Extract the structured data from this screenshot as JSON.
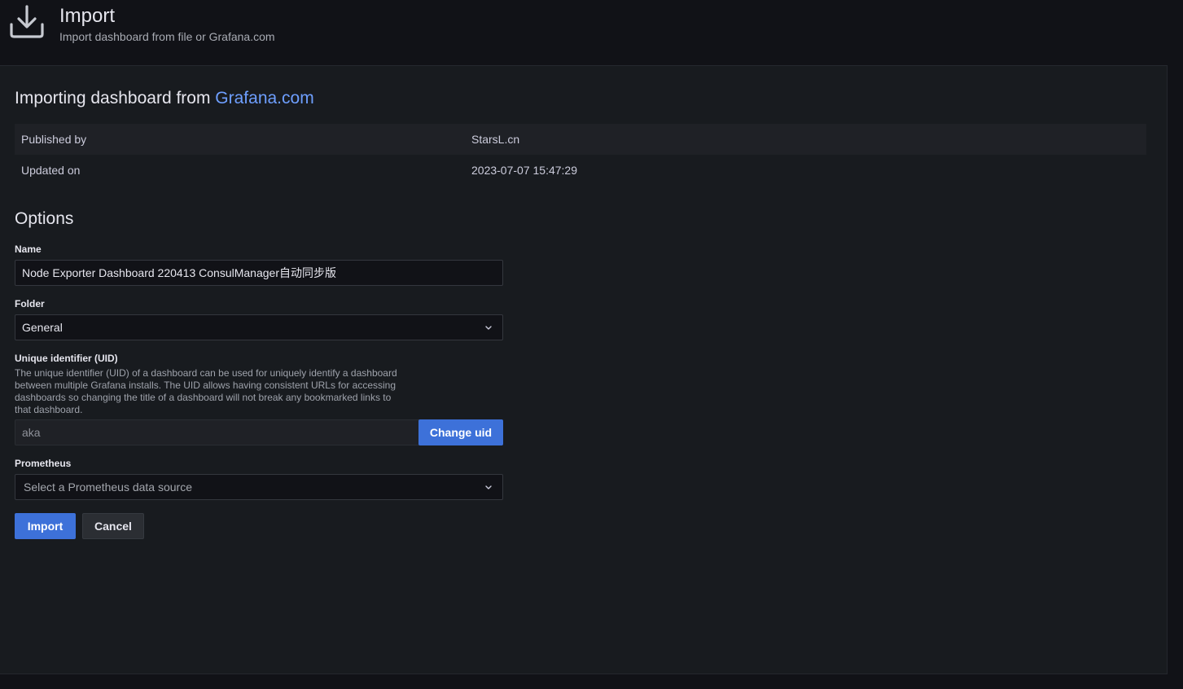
{
  "header": {
    "title": "Import",
    "subtitle": "Import dashboard from file or Grafana.com",
    "icon": "download-icon"
  },
  "import": {
    "heading_prefix": "Importing dashboard from ",
    "heading_link": "Grafana.com",
    "info": [
      {
        "key": "Published by",
        "value": "StarsL.cn"
      },
      {
        "key": "Updated on",
        "value": "2023-07-07 15:47:29"
      }
    ]
  },
  "options": {
    "heading": "Options",
    "name_label": "Name",
    "name_value": "Node Exporter Dashboard 220413 ConsulManager自动同步版",
    "folder_label": "Folder",
    "folder_value": "General",
    "uid_label": "Unique identifier (UID)",
    "uid_description": "The unique identifier (UID) of a dashboard can be used for uniquely identify a dashboard between multiple Grafana installs. The UID allows having consistent URLs for accessing dashboards so changing the title of a dashboard will not break any bookmarked links to that dashboard.",
    "uid_value": "aka",
    "change_uid_label": "Change uid",
    "prometheus_label": "Prometheus",
    "prometheus_placeholder": "Select a Prometheus data source"
  },
  "actions": {
    "import_label": "Import",
    "cancel_label": "Cancel"
  },
  "colors": {
    "background": "#111217",
    "panel": "#181b1f",
    "link": "#6e9fff",
    "primary": "#3d71d9"
  }
}
